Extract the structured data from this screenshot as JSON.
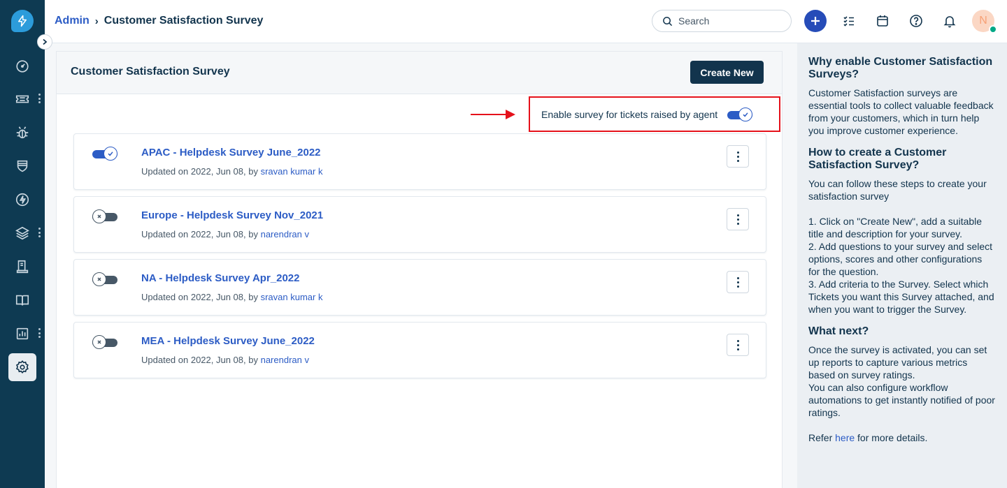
{
  "breadcrumb": {
    "parent": "Admin",
    "separator": "›",
    "current": "Customer Satisfaction Survey"
  },
  "search": {
    "placeholder": "Search"
  },
  "avatar": {
    "initial": "N"
  },
  "page": {
    "title": "Customer Satisfaction Survey",
    "create_label": "Create New"
  },
  "agent_toggle": {
    "label": "Enable survey for tickets raised by agent",
    "enabled": true
  },
  "surveys": [
    {
      "name": "APAC - Helpdesk Survey June_2022",
      "meta_prefix": "Updated on 2022, Jun 08, by",
      "user": "sravan kumar k",
      "enabled": true
    },
    {
      "name": "Europe - Helpdesk Survey Nov_2021",
      "meta_prefix": "Updated on 2022, Jun 08, by",
      "user": "narendran v",
      "enabled": false
    },
    {
      "name": "NA - Helpdesk Survey Apr_2022",
      "meta_prefix": "Updated on 2022, Jun 08, by",
      "user": "sravan kumar k",
      "enabled": false
    },
    {
      "name": "MEA - Helpdesk Survey June_2022",
      "meta_prefix": "Updated on 2022, Jun 08, by",
      "user": "narendran v",
      "enabled": false
    }
  ],
  "help": {
    "why_title": "Why enable Customer Satisfaction Surveys?",
    "why_body": "Customer Satisfaction surveys are essential tools to collect valuable feedback from your customers, which in turn help you improve customer experience.",
    "how_title": "How to create a Customer Satisfaction Survey?",
    "how_intro": "You can follow these steps to create your satisfaction survey",
    "how_step1": "1. Click on \"Create New\", add a suitable title and description for your survey.",
    "how_step2": "2. Add questions to your survey and select options, scores and other configurations for the question.",
    "how_step3": "3. Add criteria to the Survey. Select which Tickets you want this Survey attached, and when you want to trigger the Survey.",
    "next_title": "What next?",
    "next_body1": "Once the survey is activated, you can set up reports to capture various metrics based on survey ratings.",
    "next_body2": "You can also configure workflow automations to get instantly notified of poor ratings.",
    "refer_prefix": "Refer",
    "refer_link": "here",
    "refer_suffix": "for more details."
  },
  "icons": {
    "nav": [
      "dashboard-icon",
      "tickets-icon",
      "problems-icon",
      "changes-icon",
      "releases-icon",
      "assets-icon",
      "solutions-icon",
      "knowledge-icon",
      "reports-icon",
      "admin-settings-icon"
    ],
    "header": [
      "search-icon",
      "new-plus-icon",
      "tasks-icon",
      "calendar-icon",
      "help-icon",
      "notifications-icon"
    ]
  },
  "colors": {
    "nav_bg": "#0e3a52",
    "accent": "#2c5cc5",
    "primary_btn": "#12344d",
    "highlight_border": "#e5111b",
    "online": "#00a886"
  }
}
